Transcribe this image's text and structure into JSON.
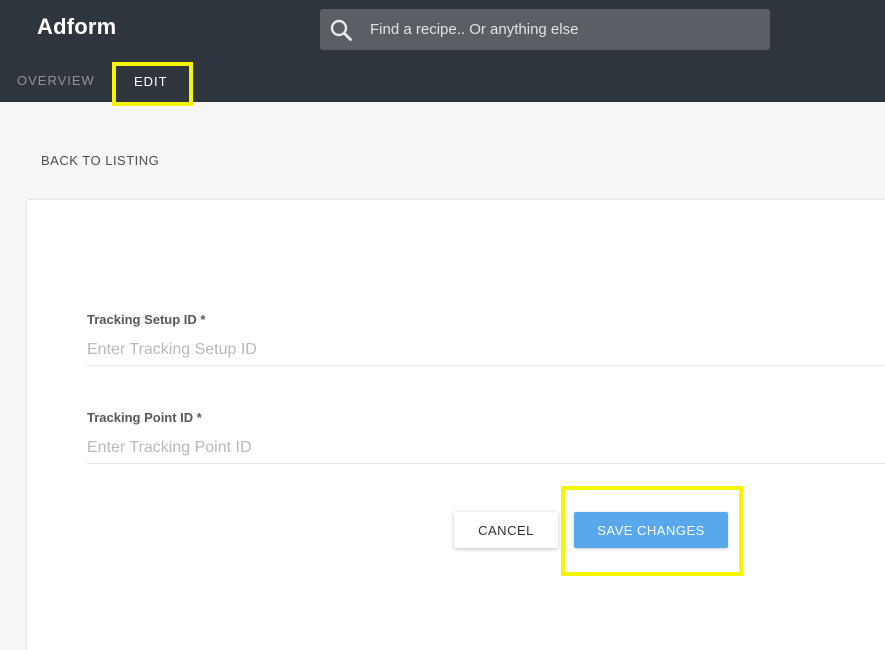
{
  "header": {
    "app_title": "Adform",
    "search": {
      "placeholder": "Find a recipe.. Or anything else",
      "value": ""
    }
  },
  "tabs": [
    {
      "label": "OVERVIEW",
      "active": false
    },
    {
      "label": "EDIT",
      "active": true,
      "highlighted": true
    }
  ],
  "nav": {
    "back_label": "BACK TO LISTING"
  },
  "form": {
    "fields": [
      {
        "label": "Tracking Setup ID *",
        "placeholder": "Enter Tracking Setup ID",
        "value": ""
      },
      {
        "label": "Tracking Point ID *",
        "placeholder": "Enter Tracking Point ID",
        "value": ""
      }
    ],
    "cancel_label": "CANCEL",
    "save_label": "SAVE CHANGES",
    "save_highlighted": true
  },
  "icons": {
    "search": "search-icon"
  },
  "colors": {
    "topbar": "#2f353c",
    "search_bg": "#5a5f66",
    "highlight": "#f5f500",
    "primary_button": "#59a8ec",
    "page_bg": "#f6f6f6"
  }
}
